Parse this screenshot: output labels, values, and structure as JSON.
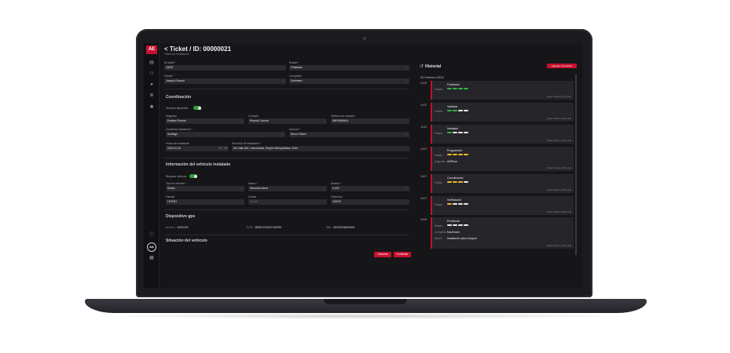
{
  "header": {
    "title": "< Ticket / ID: 00000021",
    "subtitle": "Ticket de Instalación"
  },
  "form": {
    "id_rabbit_label": "ID rabbit *",
    "id_rabbit_value": "15233",
    "estado_label": "Estado *",
    "estado_value": "Finalizado",
    "cliente_label": "Cliente *",
    "cliente_value": "Joaquin Donoso",
    "compania_label": "Compañía *",
    "compania_value": "Kaufmann",
    "coordinacion_title": "Coordinación",
    "vehiculo_disponible_label": "Vehículo disponible",
    "asignado_label": "Asignado",
    "asignado_value": "Esteban Roman",
    "contacto_label": "Contacto",
    "contacto_value": "Ricardo Concha",
    "telefono_label": "Teléfono de contacto",
    "telefono_value": "56978568424",
    "ciudad_label": "Ciudad de instalación *",
    "ciudad_value": "Santiago",
    "autorizo_label": "Autorizó *",
    "autorizo_value": "Bruno Fritsch",
    "fecha_label": "Fecha de instalación",
    "fecha_value": "2023-02-20",
    "hora_value": "16 : 05",
    "direccion_label": "Dirección de instalación *",
    "direccion_value": "Del Valle 844, Huechuraba, Región Metropolitana, Chile",
    "info_title": "Información del vehículo instalado",
    "bloquear_label": "Bloquear vehículo",
    "tipo_label": "Tipo de vehículo *",
    "tipo_value": "Sedan",
    "marca_label": "Marca *",
    "marca_value": "Mercedes-Benz",
    "modelo_label": "Modelo *",
    "modelo_value": "A 200",
    "patente_label": "Patente",
    "patente_value": "LRTD91",
    "chasis_label": "Chasis",
    "chasis_placeholder": "Chasis",
    "odometro_label": "Odómetro",
    "odometro_value": "100070",
    "gps_title": "Dispositivo gps",
    "gps_numero_label": "Número:",
    "gps_numero_value": "25091329",
    "gps_iccid_label": "ICCID:",
    "gps_iccid_value": "8956070000007165952",
    "gps_imei_label": "IMEI:",
    "gps_imei_value": "860782048065208",
    "situacion_title": "Situación del vehículo",
    "cancel_label": "Cancelar",
    "confirm_label": "Confirmar"
  },
  "history": {
    "title": "Historial",
    "add_comment_label": "Agregar comentario",
    "date": "20 Febrero 2023",
    "entries": [
      {
        "time": "18:23",
        "key": "Estado:",
        "value": "Finalizado",
        "dots": [
          "#2fb344",
          "#2fb344",
          "#2fb344",
          "#2fb344"
        ],
        "ago": "Hace 5 días y 20 horas"
      },
      {
        "time": "18:22",
        "key": "Estado:",
        "value": "Validado",
        "dots": [
          "#2fb344",
          "#2fb344",
          "#e8e8ea",
          "#e8e8ea"
        ],
        "ago": "Hace 5 días y 20 horas"
      },
      {
        "time": "18:10",
        "key": "Estado:",
        "value": "Instalado",
        "dots": [
          "#2fb344",
          "#e8e8ea",
          "#e8e8ea",
          "#e8e8ea"
        ],
        "ago": "Hace 5 días y 20 horas"
      },
      {
        "time": "18:07",
        "key": "Estado:",
        "value": "Programado",
        "key2": "Asignado:",
        "value2": "ANPhon",
        "dots": [
          "#e8b923",
          "#e8b923",
          "#e8b923",
          "#e8b923"
        ],
        "ago": "Hace 5 días y 20 horas"
      },
      {
        "time": "18:07",
        "key": "Estado:",
        "value": "Coordinación",
        "dots": [
          "#e8b923",
          "#e8b923",
          "#e8b923",
          "#e8e8ea"
        ],
        "ago": "Hace 5 días y 20 horas"
      },
      {
        "time": "18:07",
        "key": "Estado:",
        "value": "Verificación",
        "dots": [
          "#e8b923",
          "#e8e8ea",
          "#e8e8ea",
          "#e8e8ea"
        ],
        "ago": "Hace 5 días y 20 horas"
      },
      {
        "time": "18:06",
        "key": "Estado:",
        "value": "Pendiente",
        "key2": "Compañía:",
        "value2": "Kaufmann",
        "key3": "Motivo:",
        "value3": "Instalación para Joaquín",
        "dots": [
          "#e8e8ea",
          "#e8e8ea",
          "#e8e8ea",
          "#e8e8ea"
        ],
        "ago": "Hace 5 días y 20 horas"
      }
    ]
  },
  "sidebar": {
    "logo_text": "AE",
    "avatar_initials": "AA",
    "icons": [
      "clipboard-icon",
      "users-icon",
      "user-icon",
      "list-icon",
      "gear-icon"
    ]
  }
}
